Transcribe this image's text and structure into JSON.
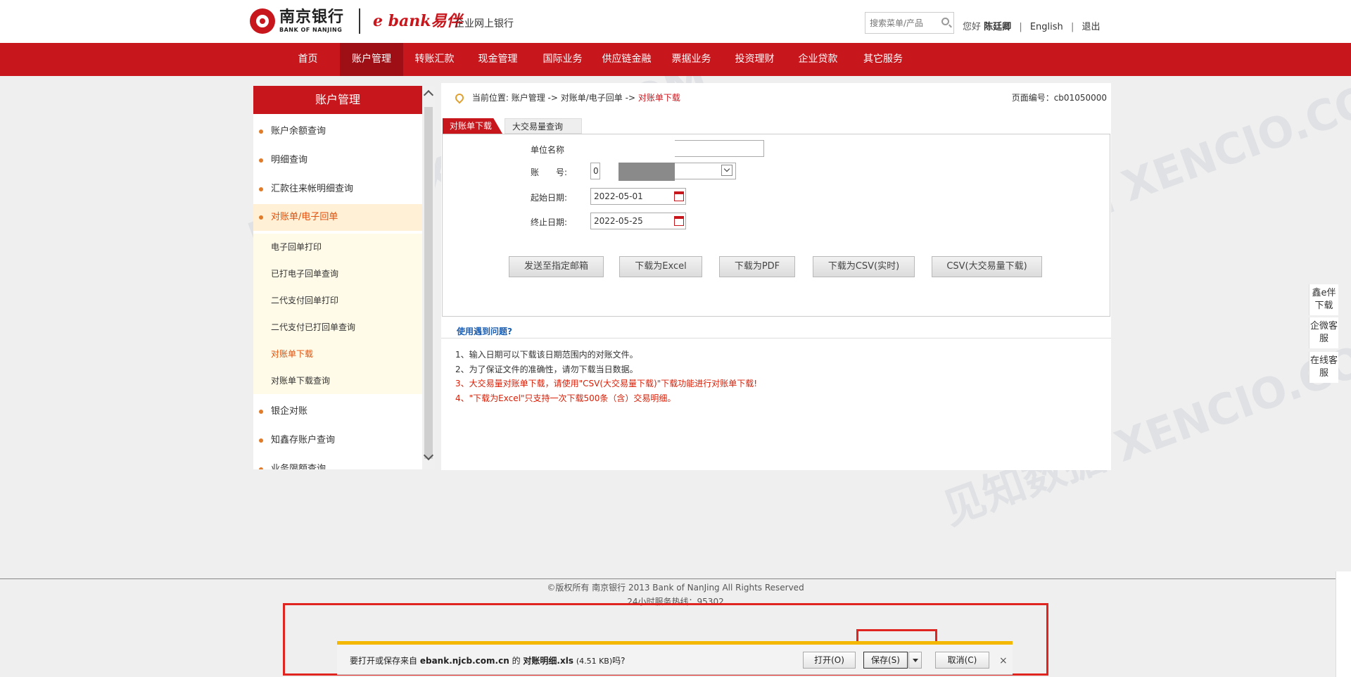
{
  "header": {
    "bank_cn": "南京银行",
    "bank_en": "BANK OF NANJING",
    "ebank_logo": "e bank易伴",
    "subtitle": "企业网上银行",
    "search_placeholder": "搜索菜单/产品",
    "greeting": "您好",
    "user_name": "陈廷卿",
    "english_link": "English",
    "logout_link": "退出"
  },
  "nav": {
    "items": [
      "首页",
      "账户管理",
      "转账汇款",
      "现金管理",
      "国际业务",
      "供应链金融",
      "票据业务",
      "投资理财",
      "企业贷款",
      "其它服务"
    ],
    "active": "账户管理"
  },
  "sidebar": {
    "title": "账户管理",
    "items": [
      "账户余额查询",
      "明细查询",
      "汇款往来帐明细查询",
      "对账单/电子回单"
    ],
    "subitems": [
      "电子回单打印",
      "已打电子回单查询",
      "二代支付回单打印",
      "二代支付已打回单查询",
      "对账单下载",
      "对账单下载查询"
    ],
    "items_after": [
      "银企对账",
      "知鑫存账户查询",
      "业务限额查询"
    ]
  },
  "breadcrumb": {
    "label": "当前位置:",
    "path1": "账户管理",
    "arrow": "->",
    "path2": "对账单/电子回单",
    "current": "对账单下载"
  },
  "page_no": "页面编号：cb01050000",
  "tabs": {
    "active": "对账单下载",
    "other": "大交易量查询"
  },
  "form": {
    "unit_label": "单位名称",
    "account_label": "账　　号:",
    "account_value": "0",
    "start_label": "起始日期:",
    "start_value": "2022-05-01",
    "end_label": "终止日期:",
    "end_value": "2022-05-25"
  },
  "buttons": [
    "发送至指定邮箱",
    "下载为Excel",
    "下载为PDF",
    "下载为CSV(实时)",
    "CSV(大交易量下载)"
  ],
  "help": {
    "title": "使用遇到问题?",
    "tips": [
      "1、输入日期可以下载该日期范围内的对账文件。",
      "2、为了保证文件的准确性，请勿下载当日数据。",
      "3、大交易量对账单下载，请使用\"CSV(大交易量下载)\"下载功能进行对账单下载!",
      "4、\"下载为Excel\"只支持一次下载500条（含）交易明细。"
    ]
  },
  "footer": {
    "copyright": "©版权所有 南京银行 2013 Bank of NanJing All Rights Reserved",
    "hotline": "24小时服务热线：95302"
  },
  "float_tabs": [
    "鑫e伴下载",
    "企微客服",
    "在线客服"
  ],
  "download_bar": {
    "prompt_prefix": "要打开或保存来自",
    "domain": "ebank.njcb.com.cn",
    "prompt_mid": "的",
    "filename": "对账明细.xls",
    "size": "(4.51 KB)",
    "prompt_suffix": "吗?",
    "open": "打开(O)",
    "save": "保存(S)",
    "cancel": "取消(C)",
    "close": "×"
  },
  "watermark": "见知数据 XENCIO.COM",
  "colors": {
    "brand_red": "#c8161d",
    "nav_active": "#9e0f15",
    "highlight": "#e0241f",
    "tip_red": "#d81e06"
  }
}
